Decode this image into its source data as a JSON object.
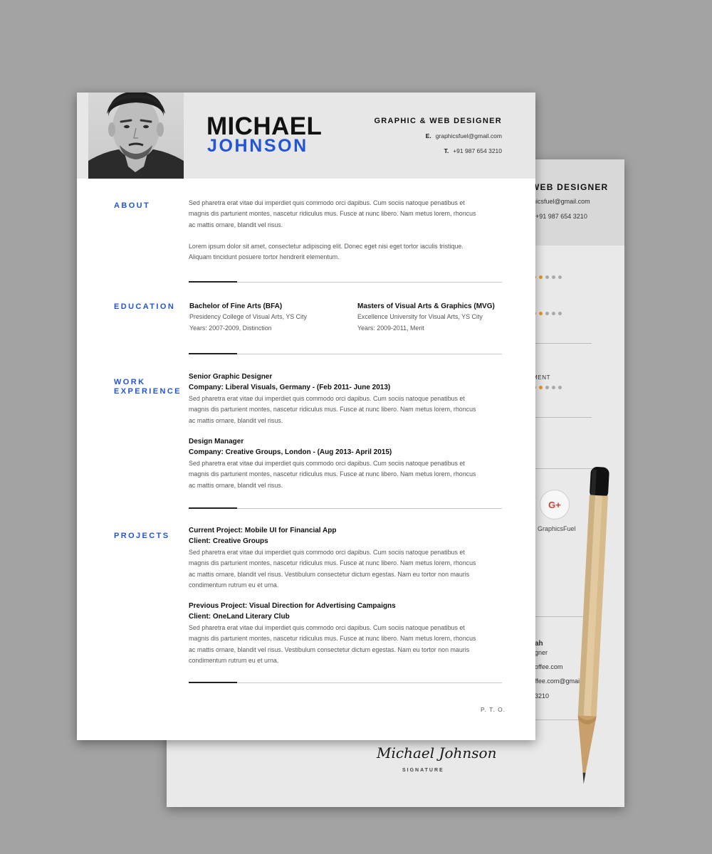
{
  "back_page": {
    "title": "WEB DESIGNER",
    "email": "hicsfuel@gmail.com",
    "phone": "+91 987 654 3210",
    "skill_label": "MENT",
    "social_icon": "G+",
    "social_label": "GraphicsFuel",
    "ref_name": "ah",
    "ref_role": "gner",
    "ref_email1": "offee.com",
    "ref_email2": "ffee.com@gmail.c",
    "ref_phone": "3210",
    "signature": "Michael Johnson",
    "signature_label": "SIGNATURE",
    "accent_color": "#e59522"
  },
  "header": {
    "first_name": "MICHAEL",
    "last_name": "JOHNSON",
    "job_title": "GRAPHIC & WEB DESIGNER",
    "email_prefix": "E.",
    "email": "graphicsfuel@gmail.com",
    "phone_prefix": "T.",
    "phone": "+91 987 654 3210"
  },
  "about": {
    "label": "ABOUT",
    "para1_line1": "Sed pharetra erat vitae dui imperdiet quis commodo orci dapibus. Cum sociis natoque penatibus et",
    "para1_line2": "magnis dis parturient montes, nascetur ridiculus mus. Fusce at nunc libero. Nam metus lorem, rhoncus",
    "para1_line3": "ac mattis ornare, blandit vel risus.",
    "para2_line1": "Lorem ipsum dolor sit amet, consectetur adipiscing elit. Donec eget nisi eget tortor iaculis tristique.",
    "para2_line2": "Aliquam tincidunt posuere tortor hendrerit elementum."
  },
  "education": {
    "label": "EDUCATION",
    "items": [
      {
        "degree": "Bachelor of Fine Arts (BFA)",
        "school": "Presidency College of Visual Arts, YS City",
        "years": "Years: 2007-2009,  Distinction"
      },
      {
        "degree": "Masters of Visual Arts & Graphics (MVG)",
        "school": "Excellence University for Visual Arts, YS City",
        "years": "Years: 2009-2011, Merit"
      }
    ]
  },
  "work": {
    "label_line1": "WORK",
    "label_line2": "EXPERIENCE",
    "items": [
      {
        "title": "Senior Graphic Designer",
        "company": "Company: Liberal Visuals, Germany -  (Feb 2011- June 2013)",
        "line1": "Sed pharetra erat vitae dui imperdiet quis commodo orci dapibus. Cum sociis natoque penatibus et",
        "line2": "magnis dis parturient montes, nascetur ridiculus mus. Fusce at nunc libero. Nam metus lorem, rhoncus",
        "line3": "ac mattis ornare, blandit vel risus."
      },
      {
        "title": "Design Manager",
        "company": "Company: Creative Groups, London -  (Aug 2013- April 2015)",
        "line1": "Sed pharetra erat vitae dui imperdiet quis commodo orci dapibus. Cum sociis natoque penatibus et",
        "line2": "magnis dis parturient montes, nascetur ridiculus mus. Fusce at nunc libero. Nam metus lorem, rhoncus",
        "line3": "ac mattis ornare, blandit vel risus."
      }
    ]
  },
  "projects": {
    "label": "PROJECTS",
    "items": [
      {
        "title": "Current Project:   Mobile UI for Financial App",
        "client": "Client: Creative Groups",
        "line1": "Sed pharetra erat vitae dui imperdiet quis commodo orci dapibus. Cum sociis natoque penatibus et",
        "line2": "magnis dis parturient montes, nascetur ridiculus mus. Fusce at nunc libero. Nam metus lorem, rhoncus",
        "line3": "ac mattis ornare, blandit vel risus. Vestibulum consectetur dictum egestas. Nam eu tortor non mauris",
        "line4": "condimentum rutrum eu et urna."
      },
      {
        "title": "Previous Project:   Visual Direction for Advertising Campaigns",
        "client": "Client: OneLand Literary Club",
        "line1": "Sed pharetra erat vitae dui imperdiet quis commodo orci dapibus. Cum sociis natoque penatibus et",
        "line2": "magnis dis parturient montes, nascetur ridiculus mus. Fusce at nunc libero. Nam metus lorem, rhoncus",
        "line3": "ac mattis ornare, blandit vel risus. Vestibulum consectetur dictum egestas. Nam eu tortor non mauris",
        "line4": "condimentum rutrum eu et urna."
      }
    ]
  },
  "footer": {
    "pto": "P. T. O."
  },
  "colors": {
    "name_blue": "#2154d6",
    "page_bg": "#a3a3a3",
    "header_bg": "#e7e7e7"
  }
}
